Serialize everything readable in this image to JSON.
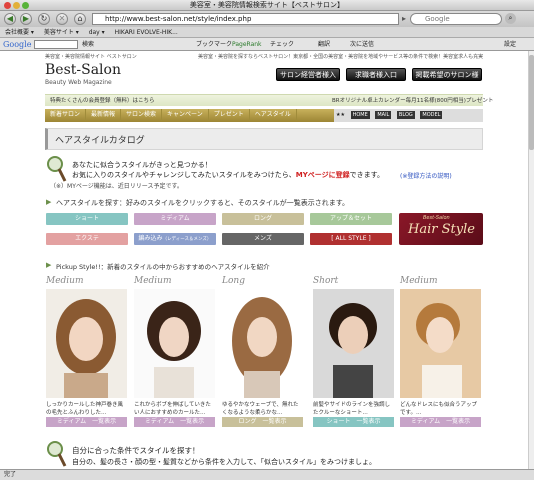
{
  "browser": {
    "window_title": "美容室・美容院情報検索サイト【ベストサロン】",
    "url": "http://www.best-salon.net/style/index.php",
    "search_placeholder": "Google",
    "bookmarks": [
      "会社概要 ▾",
      "美容サイト ▾",
      "day ▾",
      "HIKARI EVOLVE-HIK..."
    ],
    "google_bar": {
      "logo": "Google",
      "search_label": "検索",
      "bookmarks_label": "ブックマーク",
      "pagerank_label": "PageRank",
      "check_label": "チェック",
      "translate_label": "翻訳",
      "send_label": "次に送信",
      "settings_label": "設定"
    },
    "status": "完了"
  },
  "site": {
    "logo": "Best-Salon",
    "logo_sub": "Beauty Web Magazine",
    "tagline_left": "美容室・美容院情報サイト ベストサロン",
    "tagline_right": "美容室・美容院を探すならベストサロン！東京都・全国の美容室・美容院を地域やサービス等の条件で検索！美容室求人も充実",
    "header_buttons": [
      "サロン経営者様入口",
      "求職者様入口",
      "掲載希望のサロン様"
    ],
    "promo_left": "特典たくさんの会員登録（無料）はこちら",
    "promo_right": "BRオリジナル卓上カレンダー毎月11名様(800円相当)プレゼント",
    "nav": [
      "新着サロン",
      "最新情報",
      "サロン検索",
      "キャンペーン",
      "プレゼント",
      "ヘアスタイル"
    ],
    "nav_icons": [
      "HOME",
      "MAIL",
      "BLOG",
      "MODEL"
    ]
  },
  "catalog": {
    "title": "ヘアスタイルカタログ",
    "intro_line1": "あなたに似合うスタイルがきっと見つかる！",
    "intro_line2a": "お気に入りのスタイルやチャレンジしてみたいスタイルをみつけたら、",
    "intro_line2b": "MYページに登録",
    "intro_line2c": "できます。",
    "intro_link": "(※登録方法の説明)",
    "intro_note": "（※）MYページ機能は、近日リリース予定です。",
    "search_heading": "ヘアスタイルを探す：好みのスタイルをクリックすると、そのスタイルが一覧表示されます。",
    "categories": [
      {
        "label": "ショート",
        "color": "#86c5c2"
      },
      {
        "label": "ミディアム",
        "color": "#c7a4c8"
      },
      {
        "label": "ロング",
        "color": "#c8c09a"
      },
      {
        "label": "アップ＆セット",
        "color": "#a7c89a"
      },
      {
        "label": "エクステ",
        "color": "#e3a1a1"
      },
      {
        "label": "編み込み",
        "sub": "（レディース＆メンズ）",
        "color": "#8c9fcc"
      },
      {
        "label": "メンズ",
        "color": "#666666"
      },
      {
        "label": "[ ALL STYLE ]",
        "color": "#b03030"
      }
    ],
    "banner_top": "Best-Salon",
    "banner_main": "Hair Style",
    "pickup_heading": "Pickup Style!!：新着のスタイルの中からおすすめのヘアスタイルを紹介",
    "pickups": [
      {
        "type": "Medium",
        "caption": "しっかりカールした神戸巻き風の毛先とふんわりした…",
        "button": "ミディアム　一覧表示"
      },
      {
        "type": "Medium",
        "caption": "これからボブを伸ばしていきたい人におすすめのカールた…",
        "button": "ミディアム　一覧表示"
      },
      {
        "type": "Long",
        "caption": "ゆるやかなウェーブで、無れたくなるような柔らかな…",
        "button": "ロング　一覧表示"
      },
      {
        "type": "Short",
        "caption": "前髪やサイドのラインを強調したクルーなショート…",
        "button": "ショート　一覧表示"
      },
      {
        "type": "Medium",
        "caption": "どんなドレスにも似合うアップです。…",
        "button": "ミディアム　一覧表示"
      }
    ],
    "condition_line1": "自分に合った条件でスタイルを探す！",
    "condition_line2": "自分の、髪の長さ・顔の型・髪質などから条件を入力して、「似合いスタイル」をみつけましょ。"
  }
}
